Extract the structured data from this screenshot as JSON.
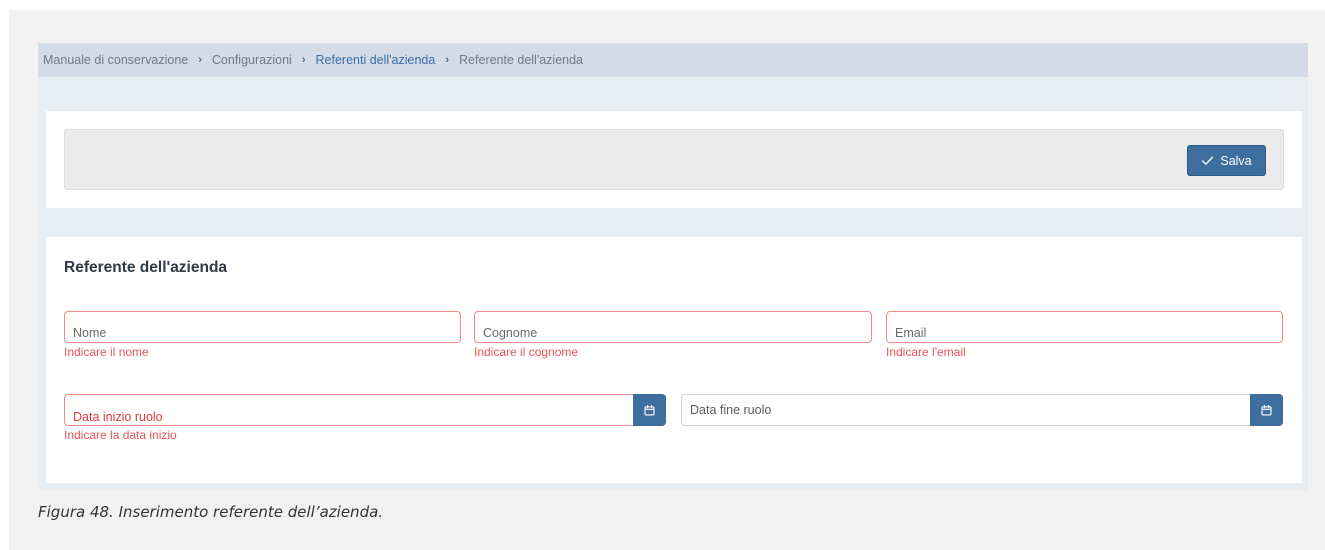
{
  "breadcrumb": {
    "items": [
      "Manuale di conservazione",
      "Configurazioni",
      "Referenti dell'azienda",
      "Referente dell'azienda"
    ],
    "separator": "›"
  },
  "toolbar": {
    "save_label": "Salva",
    "save_icon": "check-icon"
  },
  "form": {
    "title": "Referente dell'azienda",
    "fields": {
      "nome": {
        "label": "Nome",
        "error": "Indicare il nome"
      },
      "cognome": {
        "label": "Cognome",
        "error": "Indicare il cognome"
      },
      "email": {
        "label": "Email",
        "error": "Indicare l'email"
      },
      "data_inizio": {
        "label": "Data inizio ruolo",
        "error": "Indicare la data inizio"
      },
      "data_fine": {
        "label": "Data fine ruolo"
      }
    },
    "calendar_icon": "calendar-icon"
  },
  "caption": "Figura 48. Inserimento referente dell’azienda.",
  "colors": {
    "primary": "#3d6e9e",
    "error": "#e9555a",
    "breadcrumb_bg": "#d3dce6"
  }
}
